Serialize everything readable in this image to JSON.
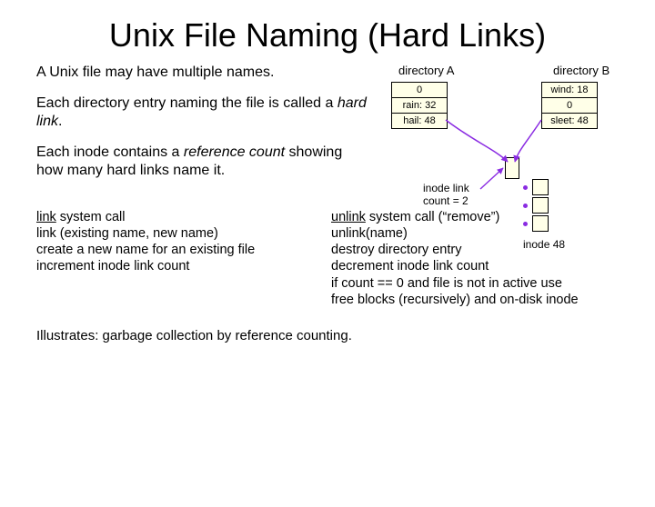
{
  "title": "Unix File Naming (Hard Links)",
  "paragraphs": {
    "p1": "A Unix file may have multiple names.",
    "p2a": "Each directory entry naming the file is called a ",
    "p2b": "hard link",
    "p2c": ".",
    "p3a": "Each inode contains a ",
    "p3b": "reference count",
    "p3c": " showing how many hard links name it."
  },
  "diagram": {
    "dirA_label": "directory A",
    "dirB_label": "directory B",
    "dirA": [
      "0",
      "rain: 32",
      "hail: 48"
    ],
    "dirB": [
      "wind: 18",
      "0",
      "sleet: 48"
    ],
    "linkcount_l1": "inode link",
    "linkcount_l2": "count = 2",
    "inode48": "inode 48"
  },
  "calls": {
    "link_title": "link system call",
    "link_sig": "link (existing name, new name)",
    "link_l1": "create a new name for an existing file",
    "link_l2": "increment inode link count",
    "unlink_title": "unlink system call (“remove”)",
    "unlink_sig": "unlink(name)",
    "unlink_l1": "destroy directory entry",
    "unlink_l2": "decrement inode link count",
    "unlink_l3": "if count == 0 and file is not in active use",
    "unlink_l4": "free blocks (recursively) and on-disk inode"
  },
  "footer": "Illustrates: garbage collection by reference counting."
}
